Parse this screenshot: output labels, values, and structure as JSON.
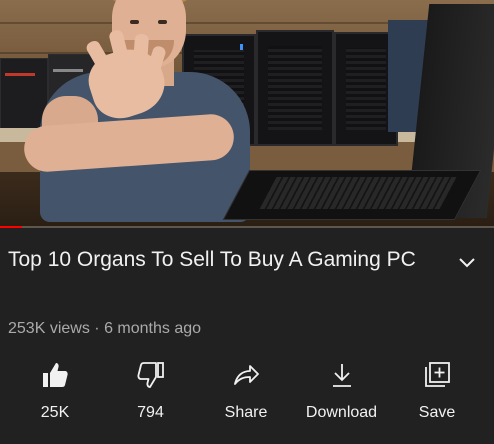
{
  "player": {
    "progress": 0.045,
    "accent_color": "#ff0000"
  },
  "video": {
    "title": "Top 10 Organs To Sell To Buy A Gaming PC",
    "views": "253K views",
    "separator": "·",
    "age": "6 months ago",
    "expand_icon": "chevron-down-icon"
  },
  "actions": [
    {
      "id": "like",
      "label": "25K",
      "icon": "thumbs-up-filled-icon"
    },
    {
      "id": "dislike",
      "label": "794",
      "icon": "thumbs-down-outline-icon"
    },
    {
      "id": "share",
      "label": "Share",
      "icon": "share-arrow-icon"
    },
    {
      "id": "download",
      "label": "Download",
      "icon": "download-icon"
    },
    {
      "id": "save",
      "label": "Save",
      "icon": "playlist-add-icon"
    }
  ]
}
